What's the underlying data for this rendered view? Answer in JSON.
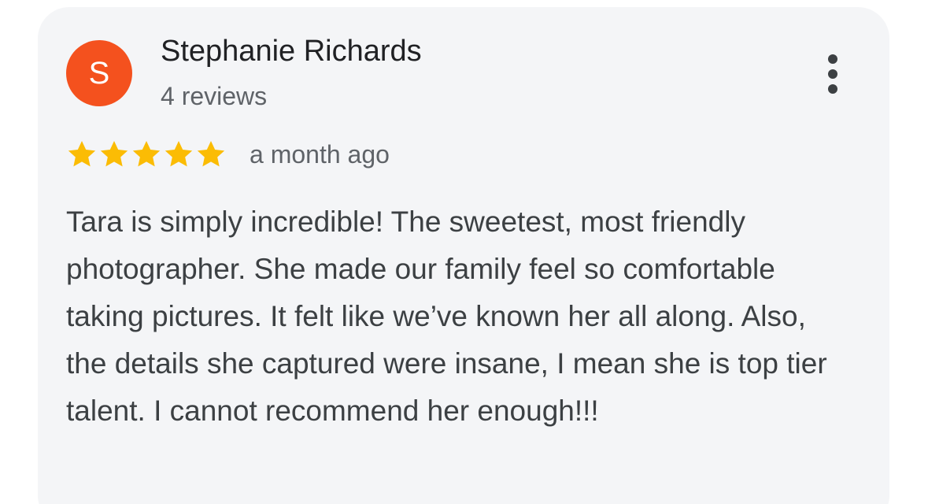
{
  "review": {
    "avatar_letter": "S",
    "author_name": "Stephanie Richards",
    "author_reviews": "4 reviews",
    "rating": 5,
    "rating_max": 5,
    "date": "a month ago",
    "text": "Tara is simply incredible! The sweetest, most friendly photographer. She made our family feel so comfortable taking pictures. It felt like we’ve known her all along. Also, the details she captured were insane, I mean she is top tier talent. I cannot recommend her enough!!!"
  },
  "icons": {
    "more": "more-vert-icon",
    "star": "star-icon"
  },
  "colors": {
    "avatar_bg": "#f4511e",
    "star": "#fbbc04",
    "card_bg": "#f4f5f7"
  }
}
